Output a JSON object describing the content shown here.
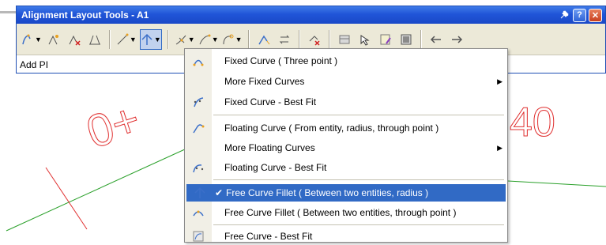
{
  "window": {
    "title": "Alignment Layout Tools - A1",
    "pin_icon": "pin-icon",
    "help_label": "?",
    "close_label": "✕"
  },
  "toolbar": {
    "tools": [
      {
        "name": "pi-commands-icon",
        "dropdown": true
      },
      {
        "name": "insert-pi-icon",
        "dropdown": false
      },
      {
        "name": "delete-pi-icon",
        "dropdown": false
      },
      {
        "name": "break-apart-pi-icon",
        "dropdown": false
      },
      {
        "name": "tangent-line-icon",
        "dropdown": true
      },
      {
        "name": "curve-commands-icon",
        "dropdown": true,
        "active": true
      },
      {
        "name": "spiral-commands-icon",
        "dropdown": true
      },
      {
        "name": "line-commands-icon",
        "dropdown": true
      },
      {
        "name": "curve-through-point-icon",
        "dropdown": true
      },
      {
        "name": "convert-autocad-icon",
        "dropdown": false
      },
      {
        "name": "reverse-direction-icon",
        "dropdown": false
      },
      {
        "name": "delete-subentity-icon",
        "dropdown": false
      },
      {
        "name": "pick-subentity-icon",
        "dropdown": false
      },
      {
        "name": "subentity-editor-icon",
        "dropdown": false
      },
      {
        "name": "alignment-grid-view-icon",
        "dropdown": false
      },
      {
        "name": "edit-properties-icon",
        "dropdown": false
      },
      {
        "name": "undo-icon",
        "dropdown": false
      },
      {
        "name": "redo-icon",
        "dropdown": false
      }
    ]
  },
  "prompt": {
    "text": "Add PI"
  },
  "drawing": {
    "left_label": "0+",
    "right_label": "40",
    "label_color": "#e03030",
    "line_color": "#2aa02a"
  },
  "menu": {
    "items": [
      {
        "label": "Fixed Curve ( Three point )",
        "icon": "fixed-curve-three-point-icon"
      },
      {
        "label": "More Fixed Curves",
        "submenu": true
      },
      {
        "label": "Fixed Curve - Best Fit",
        "icon": "fixed-curve-best-fit-icon"
      },
      {
        "label": "Floating Curve ( From entity, radius, through point )",
        "icon": "floating-curve-icon"
      },
      {
        "label": "More Floating Curves",
        "submenu": true
      },
      {
        "label": "Floating Curve - Best Fit",
        "icon": "floating-curve-best-fit-icon"
      },
      {
        "label": "Free Curve Fillet ( Between two entities, radius )",
        "icon": "free-curve-fillet-radius-icon",
        "checked": true,
        "highlighted": true
      },
      {
        "label": "Free Curve Fillet ( Between two entities, through point )",
        "icon": "free-curve-fillet-point-icon"
      },
      {
        "label": "Free Curve - Best Fit",
        "icon": "free-curve-best-fit-icon"
      }
    ]
  },
  "colors": {
    "title_bar": "#2055d8",
    "highlight": "#316ac5"
  }
}
